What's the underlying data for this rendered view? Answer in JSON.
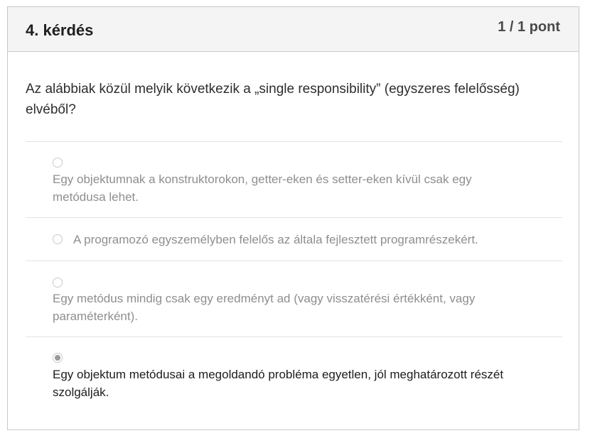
{
  "question": {
    "title": "4. kérdés",
    "points": "1 / 1 pont",
    "text": "Az alábbiak közül melyik következik a „single responsibility” (egyszeres felelősség) elvéből?"
  },
  "answers": [
    {
      "text": "Egy objektumnak a konstruktorokon, getter-eken és setter-eken kívül csak egy metódusa lehet.",
      "selected": false
    },
    {
      "text": "A programozó egyszemélyben felelős az általa fejlesztett programrészekért.",
      "selected": false
    },
    {
      "text": "Egy metódus mindig csak egy eredményt ad (vagy visszatérési értékként, vagy paraméterként).",
      "selected": false
    },
    {
      "text": "Egy objektum metódusai a megoldandó probléma egyetlen, jól meghatározott részét szolgálják.",
      "selected": true
    }
  ]
}
